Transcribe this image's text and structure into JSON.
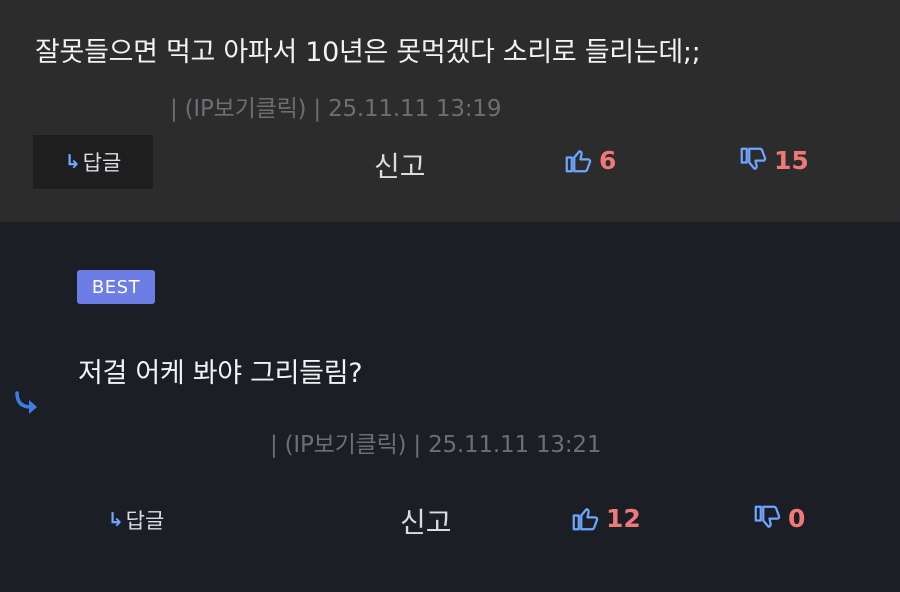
{
  "comment1": {
    "text": "잘못들으면 먹고 아파서 10년은 못먹겠다 소리로 들리는데;;",
    "meta": "| (IP보기클릭) | 25.11.11 13:19",
    "reply_label": "답글",
    "report_label": "신고",
    "likes": "6",
    "dislikes": "15"
  },
  "comment2": {
    "badge": "BEST",
    "text": "저걸 어케 봐야 그리들림?",
    "meta": "| (IP보기클릭) | 25.11.11 13:21",
    "reply_label": "답글",
    "report_label": "신고",
    "likes": "12",
    "dislikes": "0"
  },
  "colors": {
    "top_bg": "#2c2c2c",
    "bottom_bg": "#1b1e25",
    "badge": "#6c7de6",
    "vote_count": "#f07878",
    "icon_blue": "#6ea6ff"
  },
  "icons": {
    "reply": "reply-arrow-icon",
    "like": "thumbs-up-icon",
    "dislike": "thumbs-down-icon",
    "nested": "nested-reply-icon"
  }
}
